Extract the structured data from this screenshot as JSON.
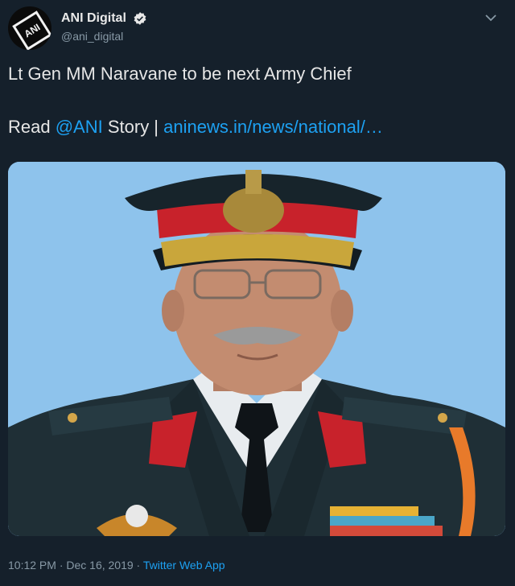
{
  "tweet": {
    "display_name": "ANI Digital",
    "handle": "@ani_digital",
    "avatar_text": "ANI",
    "headline": "Lt Gen MM Naravane to be next Army Chief",
    "read_prefix": "Read ",
    "mention": "@ANI",
    "story_text": " Story | ",
    "link_text": "aninews.in/news/national/…",
    "timestamp": "10:12 PM · Dec 16, 2019 · ",
    "source": "Twitter Web App"
  },
  "colors": {
    "background": "#15202b",
    "link": "#1da1f2",
    "muted": "#8899a6",
    "verified": "#e8e8e8"
  }
}
